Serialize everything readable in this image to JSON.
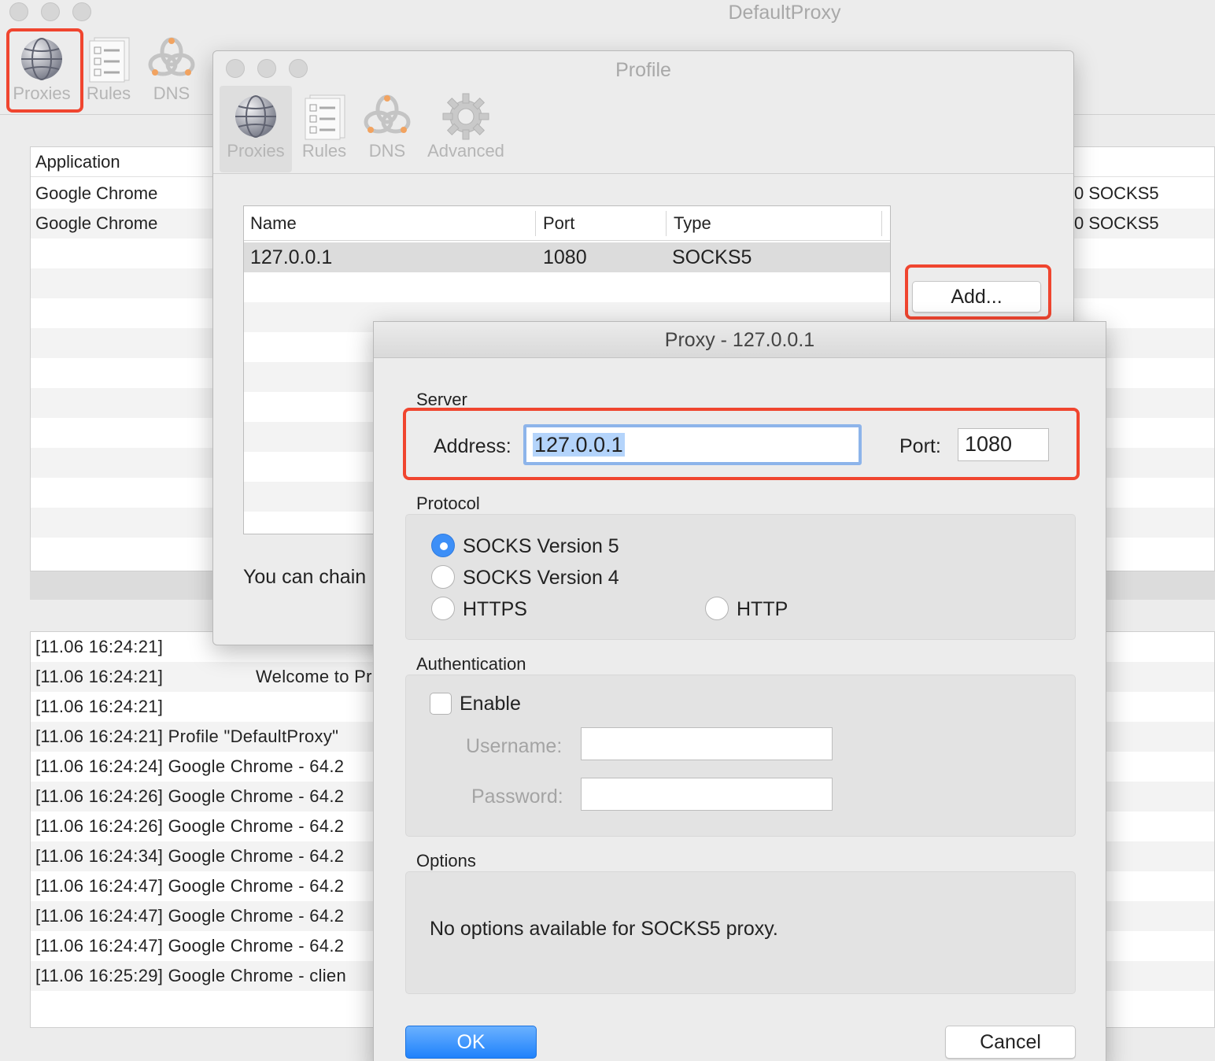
{
  "main_window": {
    "title": "DefaultProxy",
    "toolbar": [
      {
        "label": "Proxies",
        "icon": "globe-icon"
      },
      {
        "label": "Rules",
        "icon": "checklist-icon"
      },
      {
        "label": "DNS",
        "icon": "dns-network-icon"
      }
    ],
    "app_table": {
      "header": "Application",
      "rows": [
        {
          "app": "Google Chrome",
          "right_fragment": "0 SOCKS5"
        },
        {
          "app": "Google Chrome",
          "right_fragment": "0 SOCKS5"
        }
      ]
    },
    "log": {
      "rows": [
        "[11.06 16:24:21]",
        "[11.06 16:24:21]",
        "[11.06 16:24:21]",
        "[11.06 16:24:21] Profile \"DefaultProxy\"",
        "[11.06 16:24:24] Google Chrome - 64.2",
        "[11.06 16:24:26] Google Chrome - 64.2",
        "[11.06 16:24:26] Google Chrome - 64.2",
        "[11.06 16:24:34] Google Chrome - 64.2",
        "[11.06 16:24:47] Google Chrome - 64.2",
        "[11.06 16:24:47] Google Chrome - 64.2",
        "[11.06 16:24:47] Google Chrome - 64.2",
        "[11.06 16:25:29] Google Chrome - clien"
      ],
      "welcome_fragment": "Welcome to Pr"
    }
  },
  "profile_window": {
    "title": "Profile",
    "toolbar": [
      {
        "label": "Proxies",
        "icon": "globe-icon"
      },
      {
        "label": "Rules",
        "icon": "checklist-icon"
      },
      {
        "label": "DNS",
        "icon": "dns-network-icon"
      },
      {
        "label": "Advanced",
        "icon": "gear-icon"
      }
    ],
    "proxy_table": {
      "columns": [
        "Name",
        "Port",
        "Type"
      ],
      "rows": [
        {
          "name": "127.0.0.1",
          "port": "1080",
          "type": "SOCKS5"
        }
      ]
    },
    "add_button": "Add...",
    "chain_text_fragment": "You can chain"
  },
  "proxy_sheet": {
    "title": "Proxy - 127.0.0.1",
    "server": {
      "section_label": "Server",
      "address_label": "Address:",
      "address_value": "127.0.0.1",
      "port_label": "Port:",
      "port_value": "1080"
    },
    "protocol": {
      "section_label": "Protocol",
      "options": [
        {
          "label": "SOCKS Version 5",
          "selected": true
        },
        {
          "label": "SOCKS Version 4",
          "selected": false
        },
        {
          "label": "HTTPS",
          "selected": false
        },
        {
          "label": "HTTP",
          "selected": false
        }
      ]
    },
    "authentication": {
      "section_label": "Authentication",
      "enable_label": "Enable",
      "enabled": false,
      "username_label": "Username:",
      "password_label": "Password:"
    },
    "options": {
      "section_label": "Options",
      "message": "No options available for SOCKS5 proxy."
    },
    "ok_button": "OK",
    "cancel_button": "Cancel"
  },
  "colors": {
    "highlight": "#f0452f",
    "accent": "#1f82fb",
    "focus_ring": "#8db4ea"
  }
}
